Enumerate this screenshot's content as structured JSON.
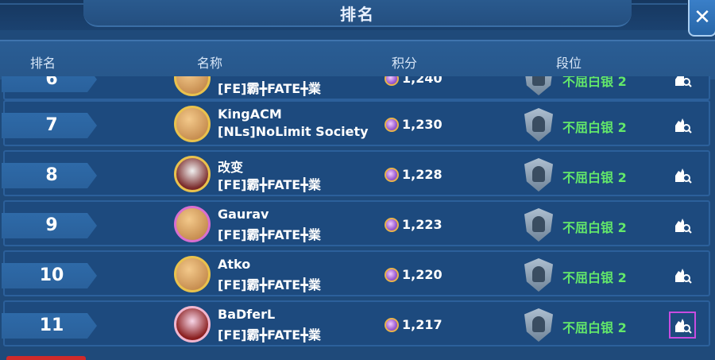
{
  "title": "排名",
  "close_label": "✕",
  "header": {
    "rank": "排名",
    "name": "名称",
    "score": "积分",
    "tier": "段位"
  },
  "rows": [
    {
      "rank": "6",
      "name": "",
      "guild": "[FE]霸╋FATE╋業",
      "score": "1,240",
      "tier": "不屈白银 2",
      "avatar_color": "#d9d9d9"
    },
    {
      "rank": "7",
      "name": "KingACM",
      "guild": "[NLs]NoLimit Society",
      "score": "1,230",
      "tier": "不屈白银 2",
      "avatar_color": "#e3b25a"
    },
    {
      "rank": "8",
      "name": "改变",
      "guild": "[FE]霸╋FATE╋業",
      "score": "1,228",
      "tier": "不屈白银 2",
      "avatar_color": "#7a2b2b"
    },
    {
      "rank": "9",
      "name": "Gaurav",
      "guild": "[FE]霸╋FATE╋業",
      "score": "1,223",
      "tier": "不屈白银 2",
      "avatar_color": "#c98a4a"
    },
    {
      "rank": "10",
      "name": "Atko",
      "guild": "[FE]霸╋FATE╋業",
      "score": "1,220",
      "tier": "不屈白银 2",
      "avatar_color": "#d79a4f"
    },
    {
      "rank": "11",
      "name": "BaDferL",
      "guild": "[FE]霸╋FATE╋業",
      "score": "1,217",
      "tier": "不屈白银 2",
      "avatar_color": "#8a1f1f"
    }
  ],
  "icons": {
    "view": "player-search-icon",
    "score": "gem-icon",
    "tier": "silver-helmet-badge-icon"
  },
  "colors": {
    "tier_text": "#63e86a",
    "highlight": "#c84ce0"
  }
}
